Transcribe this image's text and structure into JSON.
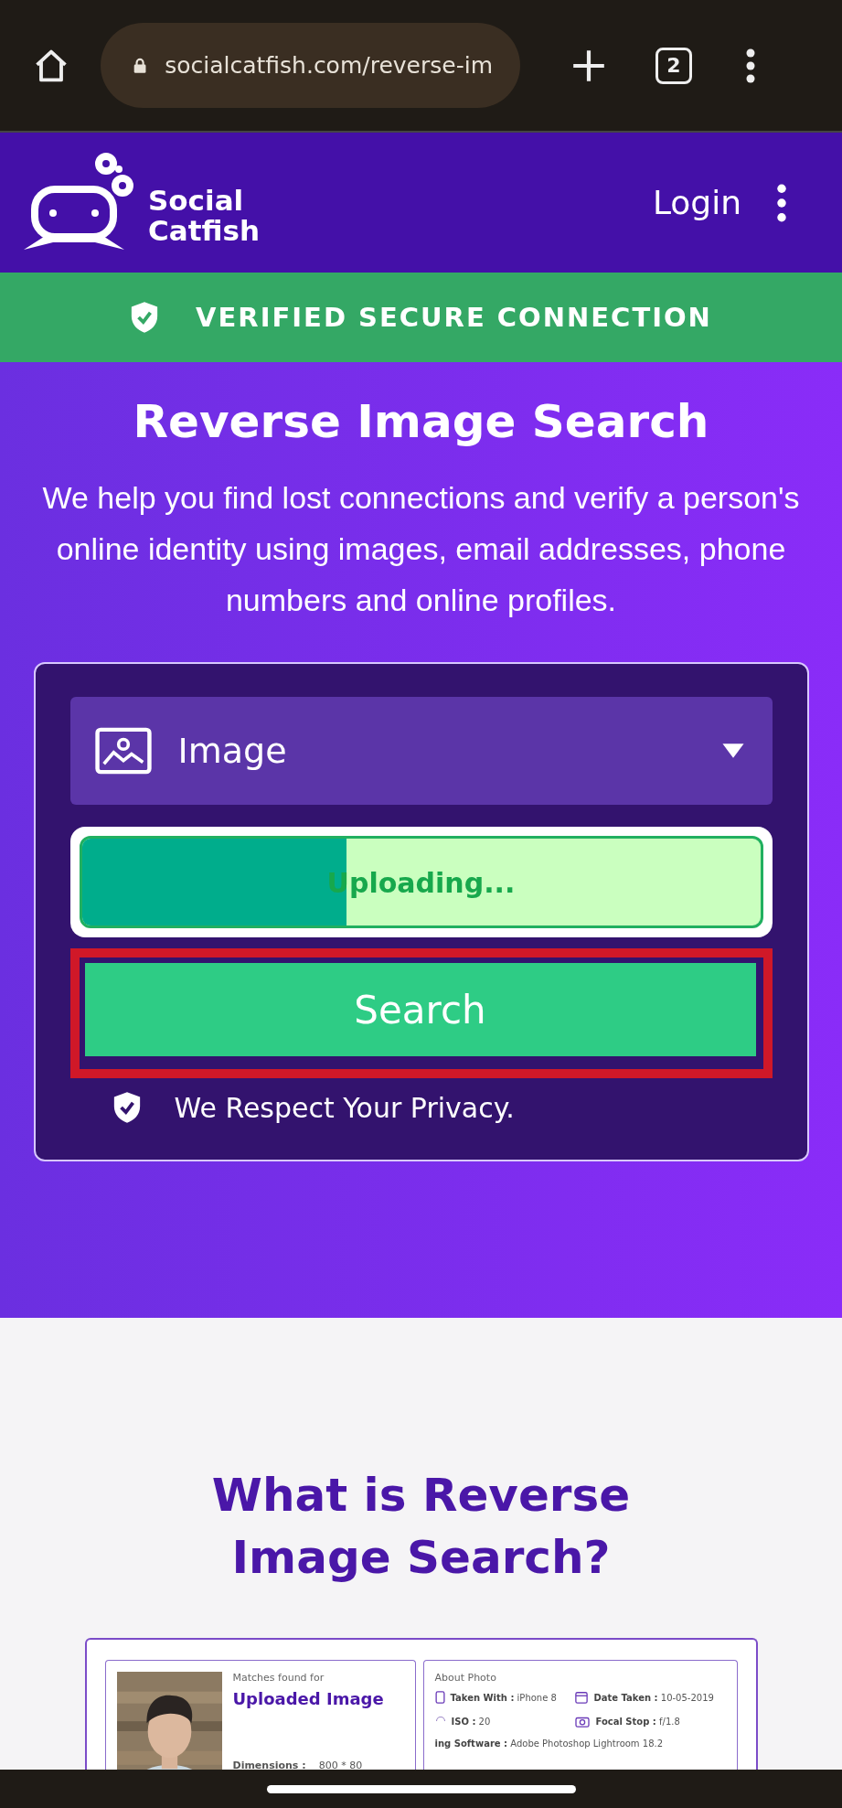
{
  "browser": {
    "url": "socialcatfish.com/reverse-im",
    "tab_count": "2"
  },
  "header": {
    "brand_line_1": "Social",
    "brand_line_2": "Catfish",
    "login": "Login"
  },
  "banner": {
    "text": "VERIFIED SECURE CONNECTION"
  },
  "hero": {
    "title": "Reverse Image Search",
    "description": "We help you find lost connections and verify a person's online identity using images, email addresses, phone numbers and online profiles."
  },
  "search_form": {
    "type_select": {
      "value": "Image"
    },
    "upload": {
      "label": "Uploading...",
      "level": 0.39
    },
    "search_button": "Search",
    "privacy": "We Respect Your Privacy."
  },
  "info": {
    "title": "What is Reverse Image Search?",
    "example": {
      "matches_label": "Matches found for",
      "matches_title": "Uploaded Image",
      "dimensions_label": "Dimensions :",
      "dimensions_value": "800 * 80",
      "about_title": "About Photo",
      "details": [
        {
          "kind": "phone",
          "label": "Taken With :",
          "value": "iPhone 8"
        },
        {
          "kind": "calendar",
          "label": "Date Taken :",
          "value": "10-05-2019"
        },
        {
          "kind": "aperture",
          "label": "ISO :",
          "value": "20"
        },
        {
          "kind": "camera",
          "label": "Focal Stop :",
          "value": "f/1.8"
        },
        {
          "kind": "none",
          "label": "ing Software :",
          "value": "Adobe Photoshop Lightroom 18.2"
        }
      ]
    }
  }
}
